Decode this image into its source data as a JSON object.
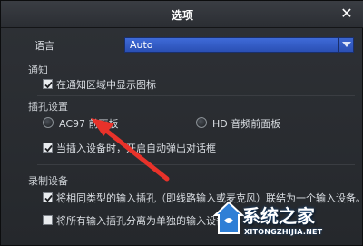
{
  "dialog": {
    "title": "选项",
    "close_glyph": "✕"
  },
  "language": {
    "label": "语言",
    "selected": "Auto"
  },
  "notify": {
    "section": "通知",
    "show_icon_label": "在通知区域中显示图标",
    "show_icon_checked": true
  },
  "jack": {
    "section": "插孔设置",
    "option_ac97": "AC97 前面板",
    "option_hd": "HD 音频前面板",
    "popup_label": "当插入设备时，开启自动弹出对话框",
    "popup_checked": true
  },
  "record": {
    "section": "录制设备",
    "combine_label": "将相同类型的输入插孔（即线路输入或麦克风）联结为一个输入设备。",
    "combine_checked": true,
    "separate_label": "将所有输入插孔分离为单独的输入设备",
    "separate_checked": false
  },
  "watermark": {
    "brand": "系统之家",
    "url": "XITONGZHIJIA.NET"
  },
  "colors": {
    "dialog_bg": "#2a2d31",
    "select_blue": "#3559c4",
    "annotation_arrow": "#e8322a"
  }
}
